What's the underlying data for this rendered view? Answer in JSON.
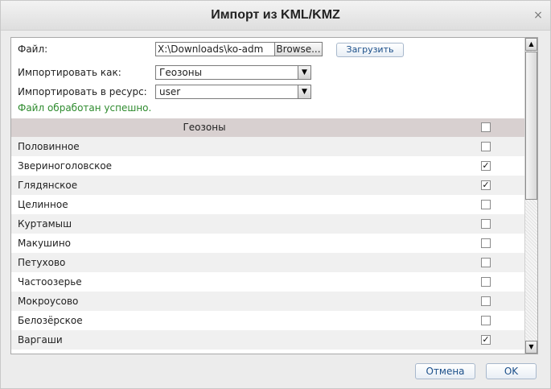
{
  "dialog": {
    "title": "Импорт из KML/KMZ",
    "close_glyph": "×"
  },
  "form": {
    "file_label": "Файл:",
    "file_value": "X:\\Downloads\\ko-adm",
    "browse_label": "Browse...",
    "upload_label": "Загрузить",
    "import_as_label": "Импортировать как:",
    "import_as_value": "Геозоны",
    "import_to_label": "Импортировать в ресурс:",
    "import_to_value": "user",
    "status_text": "Файл обработан успешно.",
    "status_color": "#2e8b2e"
  },
  "table": {
    "header": "Геозоны",
    "header_checked": false,
    "rows": [
      {
        "name": "Половинное",
        "checked": false
      },
      {
        "name": "Звериноголовское",
        "checked": true
      },
      {
        "name": "Глядянское",
        "checked": true
      },
      {
        "name": "Целинное",
        "checked": false
      },
      {
        "name": "Куртамыш",
        "checked": false
      },
      {
        "name": "Макушино",
        "checked": false
      },
      {
        "name": "Петухово",
        "checked": false
      },
      {
        "name": "Частоозерье",
        "checked": false
      },
      {
        "name": "Мокроусово",
        "checked": false
      },
      {
        "name": "Белозёрское",
        "checked": false
      },
      {
        "name": "Варгаши",
        "checked": true
      }
    ]
  },
  "footer": {
    "cancel_label": "Отмена",
    "ok_label": "OK"
  }
}
